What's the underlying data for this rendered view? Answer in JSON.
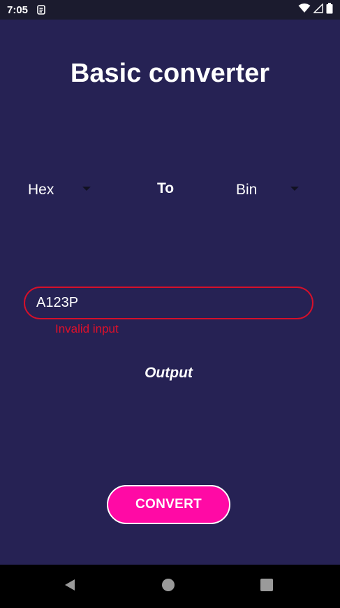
{
  "status_bar": {
    "time": "7:05",
    "left_icons": [
      "sim-toolkit-icon"
    ],
    "right_icons": [
      "wifi-icon",
      "signal-icon",
      "battery-icon"
    ]
  },
  "app": {
    "title": "Basic converter",
    "from_spinner": {
      "selected": "Hex"
    },
    "to_label": "To",
    "to_spinner": {
      "selected": "Bin"
    },
    "input": {
      "value": "A123P",
      "state": "error"
    },
    "error_text": "Invalid input",
    "output_text": "Output",
    "convert_button": "CONVERT"
  },
  "nav_bar": {
    "buttons": [
      "back-icon",
      "home-icon",
      "recents-icon"
    ]
  },
  "colors": {
    "background": "#262254",
    "status_bar": "#1b1b2e",
    "error": "#e0102a",
    "accent": "#ff0aa5"
  }
}
